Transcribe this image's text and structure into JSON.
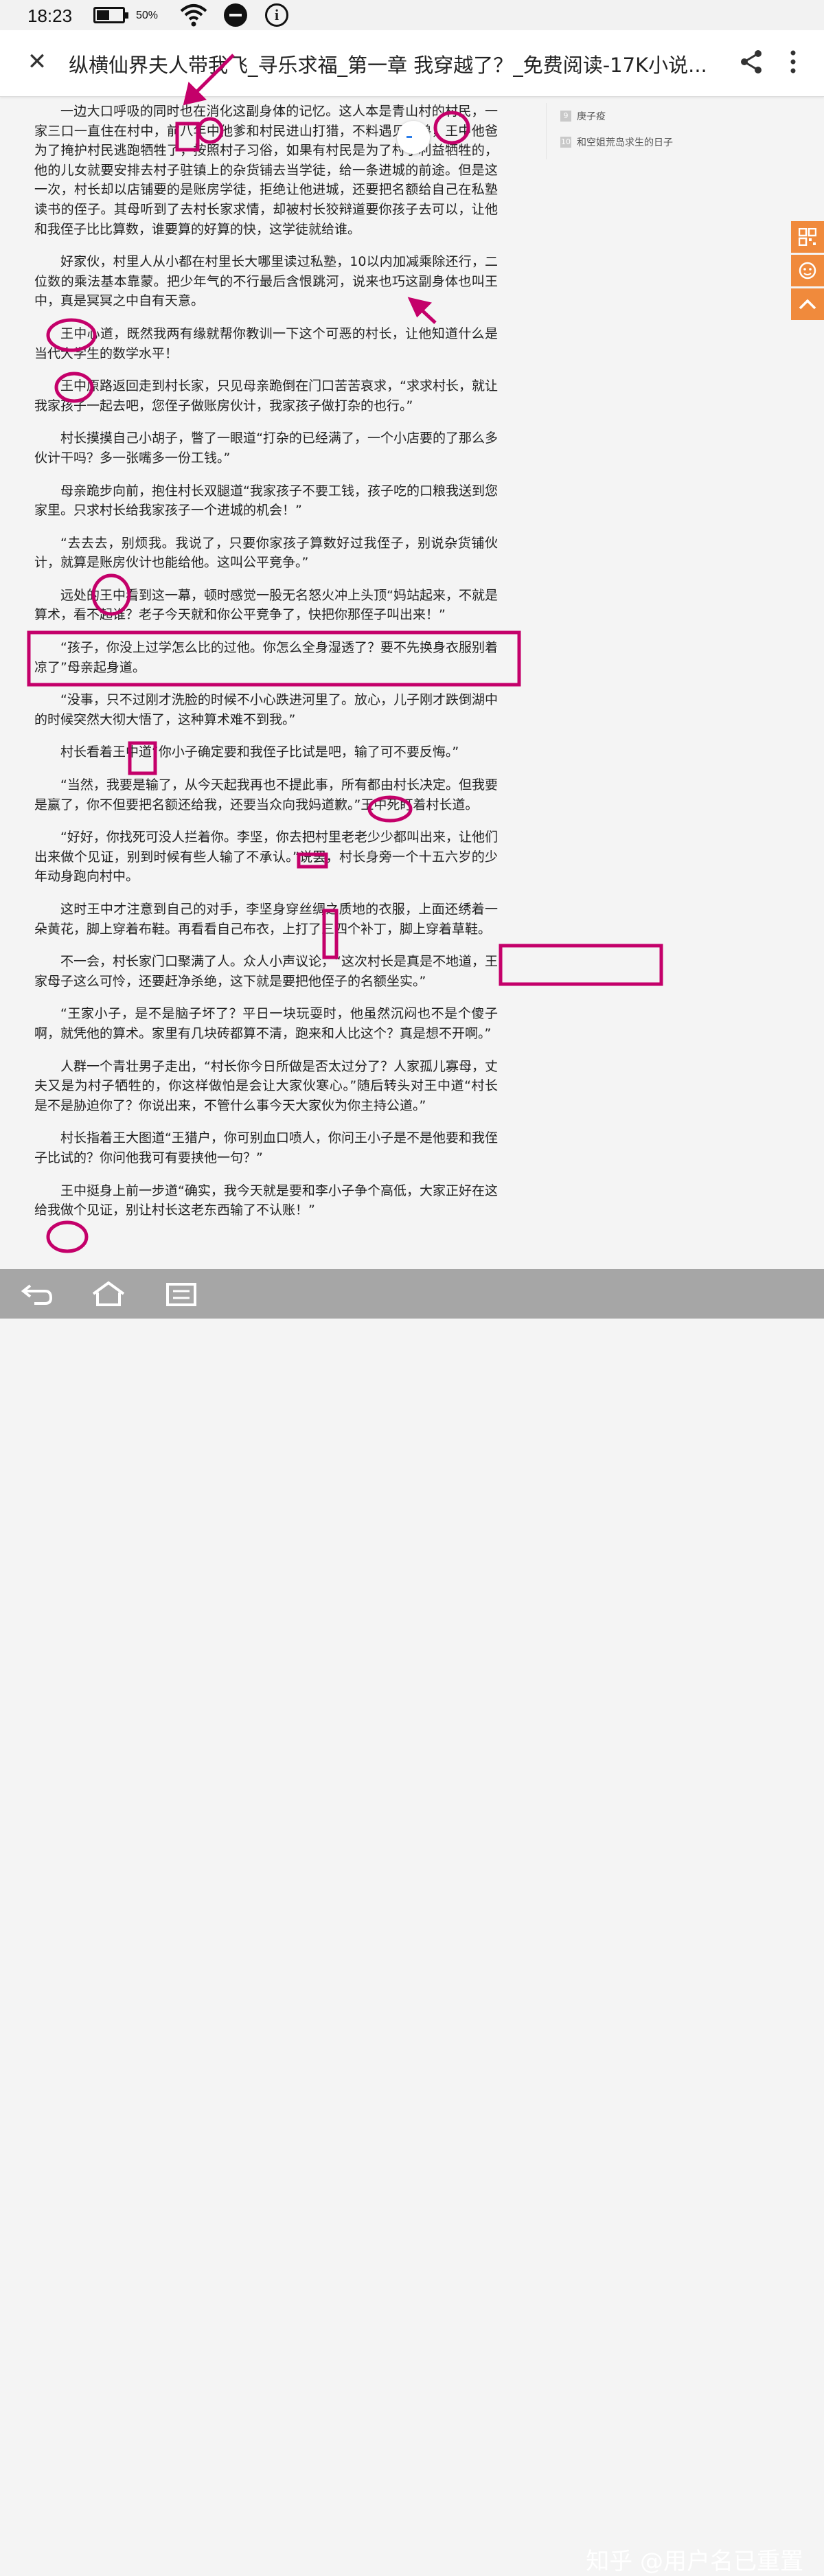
{
  "status_bar": {
    "time": "18:23",
    "battery_percent": "50%",
    "battery_level": 0.5
  },
  "header": {
    "title": "纵横仙界夫人带我飞_寻乐求福_第一章 我穿越了？_免费阅读-17K小说..."
  },
  "sidebar_list": [
    {
      "num": "9",
      "title": "庚子疫"
    },
    {
      "num": "10",
      "title": "和空姐荒岛求生的日子"
    }
  ],
  "article": {
    "paragraphs": [
      "一边大口呼吸的同时也在消化这副身体的记忆。这人本是青山村的村民，一家三口一直住在村中，前八年中他爹和村民进山打猎，不料遇见猛兽，王中他爸为了掩护村民逃跑牺牲了，按照村子习俗，如果有村民是为了村子利益牺牲的，他的儿女就要安排去村子驻镇上的杂货铺去当学徒，给一条进城的前途。但是这一次，村长却以店铺要的是账房学徒，拒绝让他进城，还要把名额给自己在私塾读书的侄子。其母听到了去村长家求情，却被村长狡辩道要你孩子去可以，让他和我侄子比比算数，谁要算的好算的快，这学徒就给谁。",
      "好家伙，村里人从小都在村里长大哪里读过私塾，10以内加减乘除还行，二位数的乘法基本靠蒙。把少年气的不行最后含恨跳河，说来也巧这副身体也叫王中，真是冥冥之中自有天意。",
      "王中心道，既然我两有缘就帮你教训一下这个可恶的村长，让他知道什么是当代大学生的数学水平！",
      "王中原路返回走到村长家，只见母亲跪倒在门口苦苦哀求，“求求村长，就让我家孩子一起去吧，您侄子做账房伙计，我家孩子做打杂的也行。”",
      "村长摸摸自己小胡子，瞥了一眼道“打杂的已经满了，一个小店要的了那么多伙计干吗？多一张嘴多一份工钱。”",
      "母亲跪步向前，抱住村长双腿道“我家孩子不要工钱，孩子吃的口粮我送到您家里。只求村长给我家孩子一个进城的机会！”",
      "“去去去，别烦我。我说了，只要你家孩子算数好过我侄子，别说杂货铺伙计，就算是账房伙计也能给他。这叫公平竞争。”",
      "远处的王中看到这一幕，顿时感觉一股无名怒火冲上头顶“妈站起来，不就是算术，看不起谁？老子今天就和你公平竞争了，快把你那侄子叫出来！”",
      "“孩子，你没上过学怎么比的过他。你怎么全身湿透了？要不先换身衣服别着凉了”母亲起身道。",
      "“没事，只不过刚才洗脸的时候不小心跌进河里了。放心，儿子刚才跌倒湖中的时候突然大彻大悟了，这种算术难不到我。”",
      "村长看着王中道“你小子确定要和我侄子比试是吧，输了可不要反悔。”",
      "“当然，我要是输了，从今天起我再也不提此事，所有都由村长决定。但我要是赢了，你不但要把名额还给我，还要当众向我妈道歉。”王中死盯着村长道。",
      "“好好，你找死可没人拦着你。李坚，你去把村里老老少少都叫出来，让他们出来做个见证，别到时候有些人输了不承认。”说罢，村长身旁一个十五六岁的少年动身跑向村中。",
      "这时王中才注意到自己的对手，李坚身穿丝绸之质地的衣服，上面还绣着一朵黄花，脚上穿着布鞋。再看看自己布衣，上打了三四个补丁，脚上穿着草鞋。",
      "不一会，村长家门口聚满了人。众人小声议论，“这次村长是真是不地道，王家母子这么可怜，还要赶净杀绝，这下就是要把他侄子的名额坐实。”",
      "“王家小子，是不是脑子坏了？平日一块玩耍时，他虽然沉闷也不是个傻子啊，就凭他的算术。家里有几块砖都算不清，跑来和人比这个？真是想不开啊。”",
      "人群一个青壮男子走出，“村长你今日所做是否太过分了？人家孤儿寡母，丈夫又是为村子牺牲的，你这样做怕是会让大家伙寒心。”随后转头对王中道“村长是不是胁迫你了？你说出来，不管什么事今天大家伙为你主持公道。”",
      "村长指着王大图道“王猎户，你可别血口喷人，你问王小子是不是他要和我侄子比试的？你问他我可有要挟他一句？”",
      "王中挺身上前一步道“确实，我今天就是要和李小子争个高低，大家正好在这给我做个见证，别让村长这老东西输了不认账！”"
    ]
  },
  "watermark": "知乎 @用户名已重置",
  "icons": {
    "close": "close-icon",
    "share": "share-icon",
    "more": "more-vert-icon",
    "qr": "qr-code-icon",
    "service": "customer-service-icon",
    "top": "back-to-top-icon",
    "nav_back": "back-icon",
    "nav_home": "home-icon",
    "nav_recent": "recent-apps-icon"
  },
  "colors": {
    "annotation": "#c4006a",
    "float_tool": "#f08a3c",
    "nav": "#a6a6a6"
  }
}
